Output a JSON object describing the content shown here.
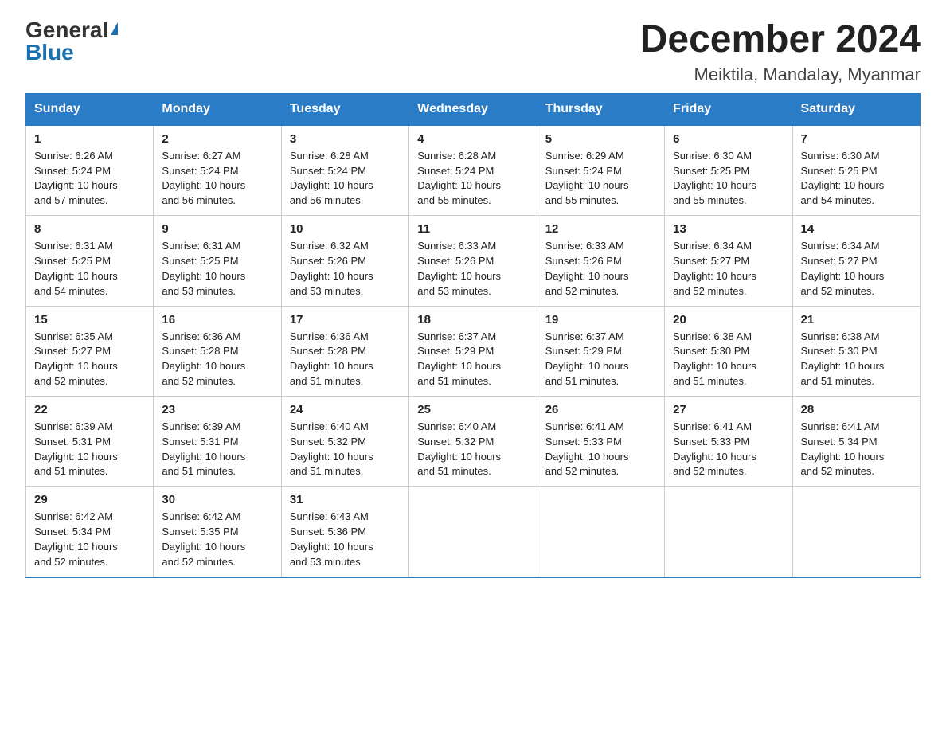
{
  "header": {
    "logo_general": "General",
    "logo_blue": "Blue",
    "month_year": "December 2024",
    "location": "Meiktila, Mandalay, Myanmar"
  },
  "weekdays": [
    "Sunday",
    "Monday",
    "Tuesday",
    "Wednesday",
    "Thursday",
    "Friday",
    "Saturday"
  ],
  "weeks": [
    [
      {
        "day": "1",
        "sunrise": "6:26 AM",
        "sunset": "5:24 PM",
        "daylight": "10 hours and 57 minutes."
      },
      {
        "day": "2",
        "sunrise": "6:27 AM",
        "sunset": "5:24 PM",
        "daylight": "10 hours and 56 minutes."
      },
      {
        "day": "3",
        "sunrise": "6:28 AM",
        "sunset": "5:24 PM",
        "daylight": "10 hours and 56 minutes."
      },
      {
        "day": "4",
        "sunrise": "6:28 AM",
        "sunset": "5:24 PM",
        "daylight": "10 hours and 55 minutes."
      },
      {
        "day": "5",
        "sunrise": "6:29 AM",
        "sunset": "5:24 PM",
        "daylight": "10 hours and 55 minutes."
      },
      {
        "day": "6",
        "sunrise": "6:30 AM",
        "sunset": "5:25 PM",
        "daylight": "10 hours and 55 minutes."
      },
      {
        "day": "7",
        "sunrise": "6:30 AM",
        "sunset": "5:25 PM",
        "daylight": "10 hours and 54 minutes."
      }
    ],
    [
      {
        "day": "8",
        "sunrise": "6:31 AM",
        "sunset": "5:25 PM",
        "daylight": "10 hours and 54 minutes."
      },
      {
        "day": "9",
        "sunrise": "6:31 AM",
        "sunset": "5:25 PM",
        "daylight": "10 hours and 53 minutes."
      },
      {
        "day": "10",
        "sunrise": "6:32 AM",
        "sunset": "5:26 PM",
        "daylight": "10 hours and 53 minutes."
      },
      {
        "day": "11",
        "sunrise": "6:33 AM",
        "sunset": "5:26 PM",
        "daylight": "10 hours and 53 minutes."
      },
      {
        "day": "12",
        "sunrise": "6:33 AM",
        "sunset": "5:26 PM",
        "daylight": "10 hours and 52 minutes."
      },
      {
        "day": "13",
        "sunrise": "6:34 AM",
        "sunset": "5:27 PM",
        "daylight": "10 hours and 52 minutes."
      },
      {
        "day": "14",
        "sunrise": "6:34 AM",
        "sunset": "5:27 PM",
        "daylight": "10 hours and 52 minutes."
      }
    ],
    [
      {
        "day": "15",
        "sunrise": "6:35 AM",
        "sunset": "5:27 PM",
        "daylight": "10 hours and 52 minutes."
      },
      {
        "day": "16",
        "sunrise": "6:36 AM",
        "sunset": "5:28 PM",
        "daylight": "10 hours and 52 minutes."
      },
      {
        "day": "17",
        "sunrise": "6:36 AM",
        "sunset": "5:28 PM",
        "daylight": "10 hours and 51 minutes."
      },
      {
        "day": "18",
        "sunrise": "6:37 AM",
        "sunset": "5:29 PM",
        "daylight": "10 hours and 51 minutes."
      },
      {
        "day": "19",
        "sunrise": "6:37 AM",
        "sunset": "5:29 PM",
        "daylight": "10 hours and 51 minutes."
      },
      {
        "day": "20",
        "sunrise": "6:38 AM",
        "sunset": "5:30 PM",
        "daylight": "10 hours and 51 minutes."
      },
      {
        "day": "21",
        "sunrise": "6:38 AM",
        "sunset": "5:30 PM",
        "daylight": "10 hours and 51 minutes."
      }
    ],
    [
      {
        "day": "22",
        "sunrise": "6:39 AM",
        "sunset": "5:31 PM",
        "daylight": "10 hours and 51 minutes."
      },
      {
        "day": "23",
        "sunrise": "6:39 AM",
        "sunset": "5:31 PM",
        "daylight": "10 hours and 51 minutes."
      },
      {
        "day": "24",
        "sunrise": "6:40 AM",
        "sunset": "5:32 PM",
        "daylight": "10 hours and 51 minutes."
      },
      {
        "day": "25",
        "sunrise": "6:40 AM",
        "sunset": "5:32 PM",
        "daylight": "10 hours and 51 minutes."
      },
      {
        "day": "26",
        "sunrise": "6:41 AM",
        "sunset": "5:33 PM",
        "daylight": "10 hours and 52 minutes."
      },
      {
        "day": "27",
        "sunrise": "6:41 AM",
        "sunset": "5:33 PM",
        "daylight": "10 hours and 52 minutes."
      },
      {
        "day": "28",
        "sunrise": "6:41 AM",
        "sunset": "5:34 PM",
        "daylight": "10 hours and 52 minutes."
      }
    ],
    [
      {
        "day": "29",
        "sunrise": "6:42 AM",
        "sunset": "5:34 PM",
        "daylight": "10 hours and 52 minutes."
      },
      {
        "day": "30",
        "sunrise": "6:42 AM",
        "sunset": "5:35 PM",
        "daylight": "10 hours and 52 minutes."
      },
      {
        "day": "31",
        "sunrise": "6:43 AM",
        "sunset": "5:36 PM",
        "daylight": "10 hours and 53 minutes."
      },
      null,
      null,
      null,
      null
    ]
  ],
  "labels": {
    "sunrise": "Sunrise:",
    "sunset": "Sunset:",
    "daylight": "Daylight:"
  }
}
